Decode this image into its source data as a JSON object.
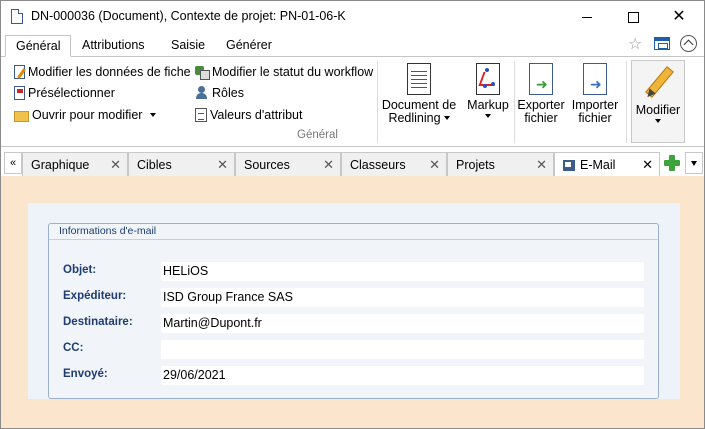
{
  "window": {
    "title": "DN-000036 (Document), Contexte de projet: PN-01-06-K",
    "minimize": "—",
    "maximize": "☐",
    "close": "✕"
  },
  "ribbon_tabs": [
    {
      "label": "Général",
      "active": true
    },
    {
      "label": "Attributions",
      "active": false
    },
    {
      "label": "Saisie",
      "active": false
    },
    {
      "label": "Générer",
      "active": false
    }
  ],
  "ribbon": {
    "small_items": {
      "modify_record": "Modifier les données de fiche",
      "preselect": "Présélectionner",
      "open_to_modify": "Ouvrir pour modifier",
      "modify_workflow": "Modifier le statut du workflow",
      "roles": "Rôles",
      "attribute_values": "Valeurs d'attribut"
    },
    "group_label": "Général",
    "big_buttons": {
      "redlining_line1": "Document de",
      "redlining_line2": "Redlining",
      "markup": "Markup",
      "export_line1": "Exporter",
      "export_line2": "fichier",
      "import_line1": "Importer",
      "import_line2": "fichier",
      "modify": "Modifier"
    }
  },
  "doc_tabs": [
    {
      "label": "Graphique",
      "active": false
    },
    {
      "label": "Cibles",
      "active": false
    },
    {
      "label": "Sources",
      "active": false
    },
    {
      "label": "Classeurs",
      "active": false
    },
    {
      "label": "Projets",
      "active": false
    },
    {
      "label": "E-Mail",
      "active": true
    }
  ],
  "doc_tabs_nav": "«",
  "tab_close": "✕",
  "email_panel": {
    "title": "Informations d'e-mail",
    "fields": [
      {
        "label": "Objet:",
        "value": "HELiOS"
      },
      {
        "label": "Expéditeur:",
        "value": "ISD Group France SAS"
      },
      {
        "label": "Destinataire:",
        "value": "Martin@Dupont.fr"
      },
      {
        "label": "CC:",
        "value": ""
      },
      {
        "label": "Envoyé:",
        "value": "29/06/2021"
      }
    ]
  },
  "icons": {
    "star": "☆"
  }
}
